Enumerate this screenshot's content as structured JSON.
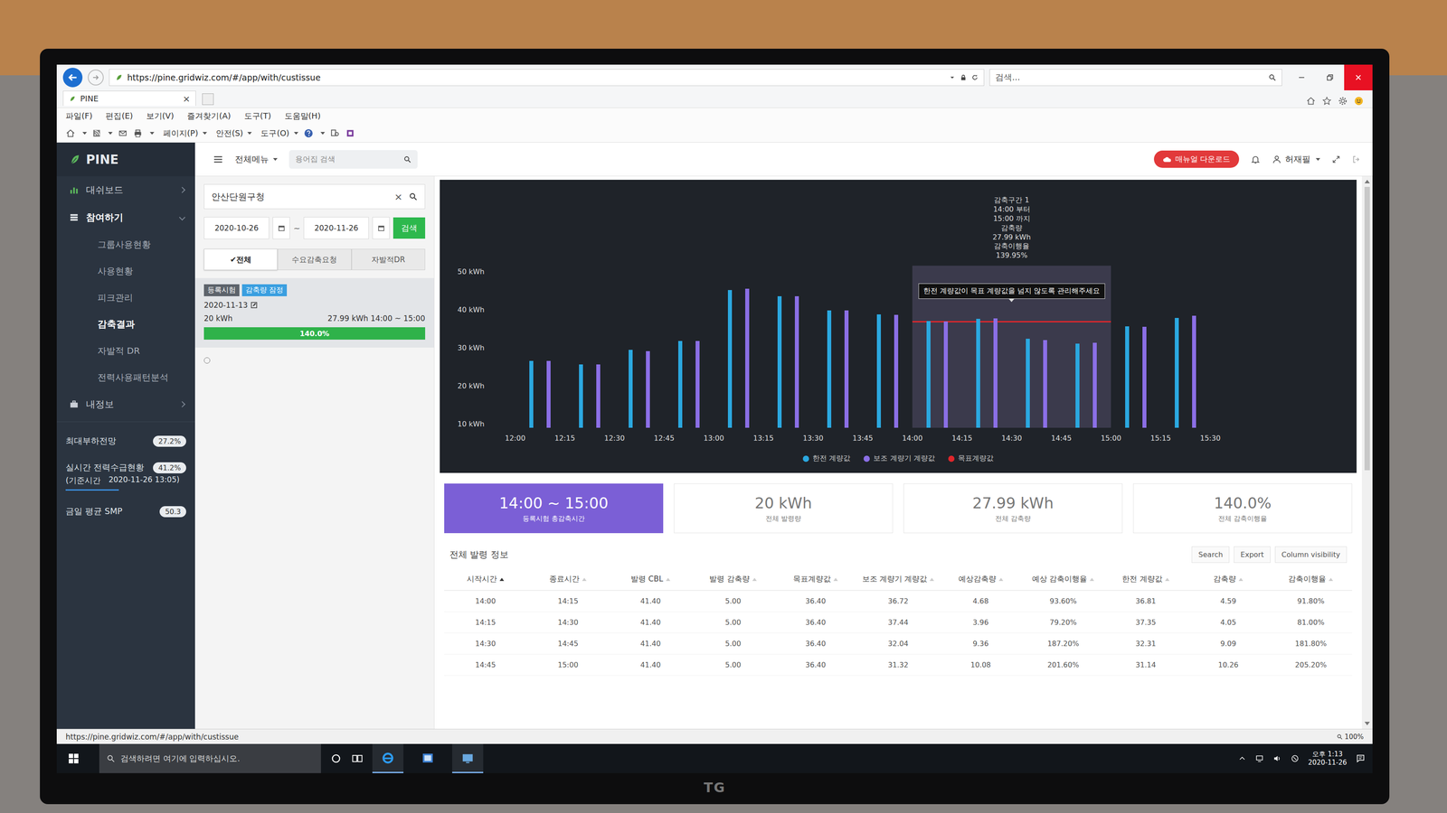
{
  "monitor": {
    "brand": "TG"
  },
  "browser": {
    "url": "https://pine.gridwiz.com/#/app/with/custissue",
    "search_placeholder": "검색...",
    "tab": {
      "label": "PINE",
      "close": "×",
      "selected": true
    },
    "menu": [
      "파일(F)",
      "편집(E)",
      "보기(V)",
      "즐겨찾기(A)",
      "도구(T)",
      "도움말(H)"
    ],
    "commands": [
      "페이지(P)",
      "안전(S)",
      "도구(O)"
    ],
    "status_url": "https://pine.gridwiz.com/#/app/with/custissue",
    "zoom": "100%"
  },
  "sidebar": {
    "logo": "PINE",
    "items": [
      {
        "label": "대쉬보드",
        "kind": "section",
        "expanded": false,
        "selected": false
      },
      {
        "label": "참여하기",
        "kind": "section",
        "expanded": true,
        "selected": true
      },
      {
        "label": "그룹사용현황",
        "kind": "sub",
        "selected": false
      },
      {
        "label": "사용현황",
        "kind": "sub",
        "selected": false
      },
      {
        "label": "피크관리",
        "kind": "sub",
        "selected": false
      },
      {
        "label": "감축결과",
        "kind": "sub",
        "selected": true
      },
      {
        "label": "자발적 DR",
        "kind": "sub",
        "selected": false
      },
      {
        "label": "전력사용패턴분석",
        "kind": "sub",
        "selected": false
      },
      {
        "label": "내정보",
        "kind": "section",
        "expanded": false,
        "selected": false
      }
    ],
    "stats": [
      {
        "label": "최대부하전망",
        "badge": "27.2%"
      },
      {
        "label": "실시간 전력수급현황",
        "note": "(기준시간",
        "time": "2020-11-26 13:05)",
        "badge": "41.2%"
      },
      {
        "label": "금일 평균 SMP",
        "badge": "50.3"
      }
    ]
  },
  "topbar": {
    "menu": "전체메뉴",
    "search_placeholder": "용어집 검색",
    "manual_button": "매뉴얼 다운로드",
    "user": "허재필"
  },
  "filter": {
    "query": "안산단원구청",
    "clear": "×",
    "date_from": "2020-10-26",
    "separator": "~",
    "date_to": "2020-11-26",
    "button": "검색",
    "tabs": [
      {
        "label": "✔전체",
        "selected": true
      },
      {
        "label": "수요감축요청",
        "selected": false
      },
      {
        "label": "자발적DR",
        "selected": false
      }
    ]
  },
  "events": [
    {
      "tags": [
        {
          "label": "등록시험",
          "color": "#5d636b"
        },
        {
          "label": "감축량 잠정",
          "color": "#3a9fe0"
        }
      ],
      "date": "2020-11-13",
      "amount": "20 kWh",
      "result": "27.99 kWh 14:00 ~ 15:00",
      "progress": "140.0%",
      "level": 1,
      "selected": true
    }
  ],
  "chart": {
    "y_ticks": [
      "50 kWh",
      "40 kWh",
      "30 kWh",
      "20 kWh",
      "10 kWh"
    ],
    "y_min": 10,
    "y_max": 50,
    "x_ticks": [
      "12:00",
      "12:15",
      "12:30",
      "12:45",
      "13:00",
      "13:15",
      "13:30",
      "13:45",
      "14:00",
      "14:15",
      "14:30",
      "14:45",
      "15:00",
      "15:15",
      "15:30"
    ],
    "series": [
      {
        "name": "한전 계량값",
        "color": "#2ba8e0",
        "values": [
          26.8,
          25.9,
          29.6,
          31.8,
          44.6,
          43.0,
          39.5,
          38.5,
          36.81,
          37.35,
          32.31,
          31.14,
          35.5,
          37.6
        ]
      },
      {
        "name": "보조 계량기 계량값",
        "color": "#8b6fe6",
        "values": [
          26.8,
          25.9,
          29.2,
          31.8,
          44.9,
          43.0,
          39.5,
          38.3,
          36.72,
          37.44,
          32.04,
          31.32,
          35.3,
          38.1
        ]
      }
    ],
    "target": {
      "name": "목표계량값",
      "color": "#e0262b",
      "value": 36.4
    },
    "highlight": {
      "from": "14:00",
      "to": "15:00"
    },
    "tooltip": [
      "감축구간 1",
      "14:00 부터",
      "15:00 까지",
      "감축량",
      "27.99 kWh",
      "감축이행율",
      "139.95%"
    ],
    "callout": "한전 계량값이 목표 계량값을 넘지 않도록 관리해주세요"
  },
  "summary": [
    {
      "value": "14:00 ~ 15:00",
      "label": "등록시험 총감축시간",
      "selected": true
    },
    {
      "value": "20 kWh",
      "label": "전체 발령량",
      "selected": false
    },
    {
      "value": "27.99 kWh",
      "label": "전체 감축량",
      "selected": false
    },
    {
      "value": "140.0%",
      "label": "전체 감축이행율",
      "selected": false
    }
  ],
  "table": {
    "title": "전체 발령 정보",
    "buttons": [
      "Search",
      "Export",
      "Column visibility"
    ],
    "columns": [
      {
        "label": "시작시간",
        "sort": "asc"
      },
      {
        "label": "종료시간",
        "sort": "none"
      },
      {
        "label": "발령 CBL",
        "sort": "none"
      },
      {
        "label": "발령 감축량",
        "sort": "none"
      },
      {
        "label": "목표계량값",
        "sort": "none"
      },
      {
        "label": "보조 계량기 계량값",
        "sort": "none"
      },
      {
        "label": "예상감축량",
        "sort": "none"
      },
      {
        "label": "예상 감축이행율",
        "sort": "none"
      },
      {
        "label": "한전 계량값",
        "sort": "none"
      },
      {
        "label": "감축량",
        "sort": "none"
      },
      {
        "label": "감축이행율",
        "sort": "none"
      }
    ],
    "rows": [
      [
        "14:00",
        "14:15",
        "41.40",
        "5.00",
        "36.40",
        "36.72",
        "4.68",
        "93.60%",
        "36.81",
        "4.59",
        "91.80%"
      ],
      [
        "14:15",
        "14:30",
        "41.40",
        "5.00",
        "36.40",
        "37.44",
        "3.96",
        "79.20%",
        "37.35",
        "4.05",
        "81.00%"
      ],
      [
        "14:30",
        "14:45",
        "41.40",
        "5.00",
        "36.40",
        "32.04",
        "9.36",
        "187.20%",
        "32.31",
        "9.09",
        "181.80%"
      ],
      [
        "14:45",
        "15:00",
        "41.40",
        "5.00",
        "36.40",
        "31.32",
        "10.08",
        "201.60%",
        "31.14",
        "10.26",
        "205.20%"
      ]
    ]
  },
  "taskbar": {
    "search_placeholder": "검색하려면 여기에 입력하십시오.",
    "time": "오후 1:13",
    "date": "2020-11-26"
  }
}
